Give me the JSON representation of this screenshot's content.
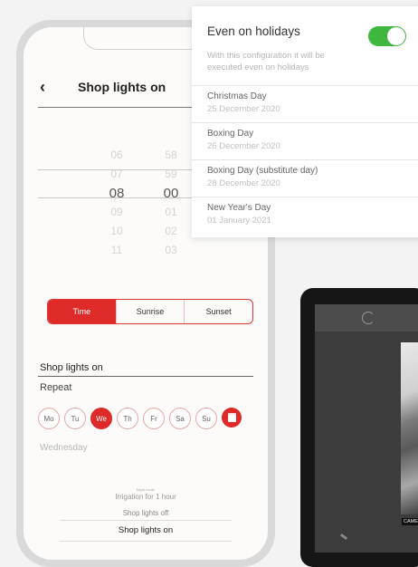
{
  "phone": {
    "back_symbol": "‹",
    "title": "Shop lights on",
    "picker": {
      "hours": [
        "",
        "06",
        "07",
        "08",
        "09",
        "10",
        "11"
      ],
      "minutes": [
        "",
        "58",
        "59",
        "00",
        "01",
        "02",
        "03"
      ],
      "selected_hour": "08",
      "selected_minute": "00"
    },
    "segments": [
      "Time",
      "Sunrise",
      "Sunset"
    ],
    "active_segment": "Time",
    "name_label": "Shop lights on",
    "repeat_label": "Repeat",
    "days": [
      "Mo",
      "Tu",
      "We",
      "Th",
      "Fr",
      "Sa",
      "Su"
    ],
    "active_day": "We",
    "selected_day_text": "Wednesday",
    "bottom_list": {
      "tiny": "Night mode",
      "item1": "Irrigation for 1 hour",
      "item2": "Shop lights off",
      "item3": "Shop lights on"
    }
  },
  "card": {
    "title": "Even on holidays",
    "toggle_on": true,
    "toggle_color": "#3fb73f",
    "description": "With this configuration it will be executed even on holidays",
    "holidays": [
      {
        "name": "Christmas Day",
        "date": "25 December 2020"
      },
      {
        "name": "Boxing Day",
        "date": "26 December 2020"
      },
      {
        "name": "Boxing Day (substitute day)",
        "date": "28 December 2020"
      },
      {
        "name": "New Year's Day",
        "date": "01 January 2021"
      }
    ]
  },
  "tablet": {
    "camera_label": "CAMERA"
  },
  "colors": {
    "accent": "#df2a2a"
  }
}
